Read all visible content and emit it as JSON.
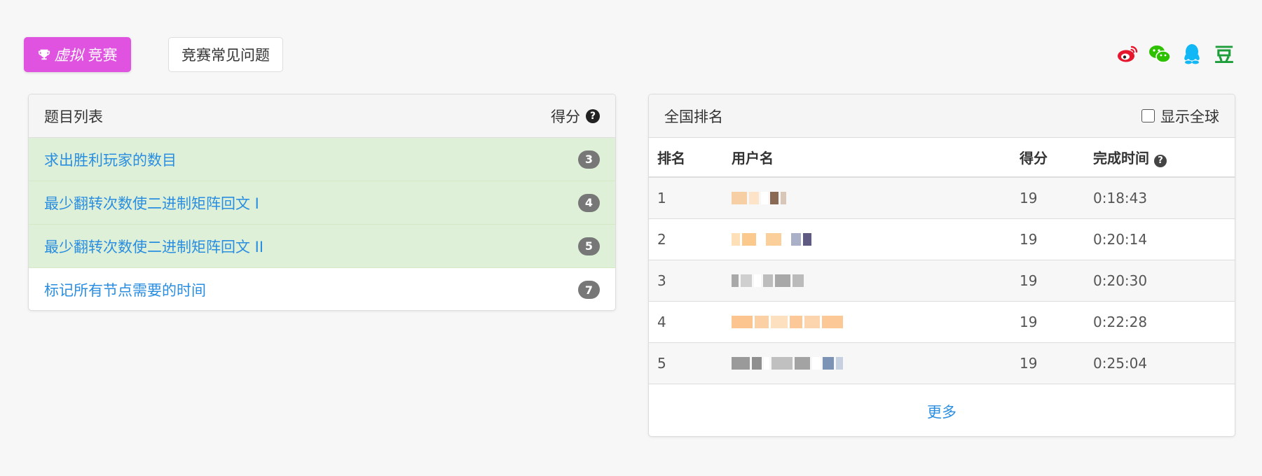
{
  "toolbar": {
    "contest_italic": "虚拟",
    "contest_label": "竞赛",
    "faq_label": "竞赛常见问题"
  },
  "share_icons": [
    "weibo-icon",
    "wechat-icon",
    "qq-icon",
    "douban-icon"
  ],
  "share_douban_glyph": "豆",
  "problems": {
    "header_title": "题目列表",
    "header_score": "得分",
    "items": [
      {
        "title": "求出胜利玩家的数目",
        "score": "3",
        "solved": true
      },
      {
        "title": "最少翻转次数使二进制矩阵回文 I",
        "score": "4",
        "solved": true
      },
      {
        "title": "最少翻转次数使二进制矩阵回文 II",
        "score": "5",
        "solved": true
      },
      {
        "title": "标记所有节点需要的时间",
        "score": "7",
        "solved": false
      }
    ]
  },
  "ranking": {
    "header_title": "全国排名",
    "show_global_label": "显示全球",
    "columns": {
      "rank": "排名",
      "user": "用户名",
      "score": "得分",
      "time": "完成时间"
    },
    "rows": [
      {
        "rank": "1",
        "score": "19",
        "time": "0:18:43"
      },
      {
        "rank": "2",
        "score": "19",
        "time": "0:20:14"
      },
      {
        "rank": "3",
        "score": "19",
        "time": "0:20:30"
      },
      {
        "rank": "4",
        "score": "19",
        "time": "0:22:28"
      },
      {
        "rank": "5",
        "score": "19",
        "time": "0:25:04"
      }
    ],
    "more_label": "更多"
  },
  "colors": {
    "contest_button": "#e052e0",
    "solved_row": "#dff0d8",
    "link": "#2a8ee0",
    "weibo": "#e6162d",
    "wechat": "#2dc100",
    "qq": "#12b7f5",
    "douban": "#1e9e3a"
  }
}
